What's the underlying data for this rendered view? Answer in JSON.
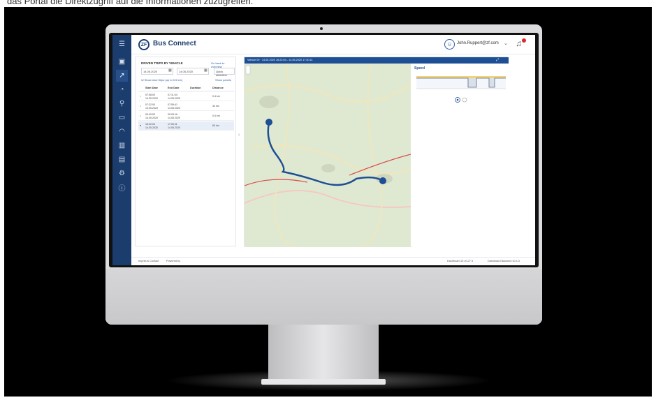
{
  "caption": "das Portal die Direktzugriff auf die Informationen zuzugreifen.",
  "app": {
    "brand": "Bus Connect",
    "logo_text": "ZF",
    "user_name": "John.Ruppert@zf.com"
  },
  "panel": {
    "title": "DRIVEN TRIPS BY VEHICLE",
    "link": "Go back to overview",
    "date_from": "14.05.2020",
    "date_to": "14.05.2020",
    "select": "Quick selection",
    "checkbox": "Show short trips (up to 0.5 km)",
    "show_panels": "Show panels",
    "headers": [
      "Start Date",
      "End Date",
      "Duration",
      "Distance"
    ],
    "rows": [
      {
        "start_time": "07:08:00",
        "start_date": "14.05.2020",
        "end_time": "07:11:04",
        "end_date": "14.05.2020",
        "distance": "0.4 km"
      },
      {
        "start_time": "07:32:00",
        "start_date": "14.05.2020",
        "end_time": "07:55:41",
        "end_date": "14.05.2020",
        "distance": "34 km"
      },
      {
        "start_time": "09:00:53",
        "start_date": "14.05.2020",
        "end_time": "09:03:16",
        "end_date": "14.05.2020",
        "distance": "0.4 km"
      },
      {
        "start_time": "16:22:04",
        "start_date": "14.05.2020",
        "end_time": "17:00:11",
        "end_date": "14.05.2020",
        "distance": "65 km"
      }
    ]
  },
  "map_header": "Vehicle 09 · 14.05.2020 16:22:04 - 14.05.2020 17:00:11",
  "speed": {
    "title": "Speed"
  },
  "footer": {
    "imprint": "Imprint & Contact",
    "powered": "Powered by",
    "dashboard": "Dashboard UI v0.27.3",
    "backend": "Dashboard Backend v0.4.3"
  },
  "colors": {
    "sidebar": "#1b3d6e",
    "accent": "#1e4f94",
    "route": "#1e4f94",
    "alert": "#e0262f"
  }
}
